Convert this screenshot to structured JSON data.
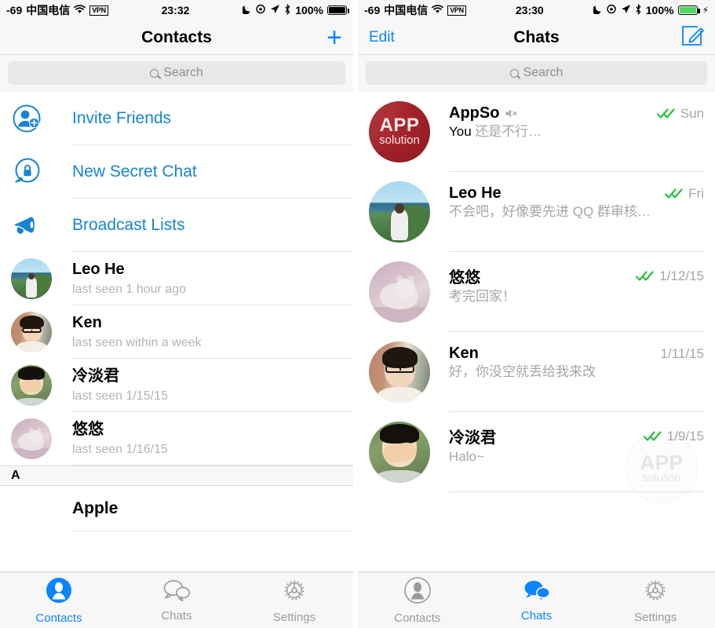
{
  "left": {
    "statusbar": {
      "signal": "-69",
      "carrier": "中国电信",
      "wifi_icon": "wifi-icon",
      "vpn": "VPN",
      "time": "23:32",
      "moon_icon": "do-not-disturb-moon-icon",
      "lock_icon": "rotation-lock-icon",
      "location_icon": "location-arrow-icon",
      "bluetooth_icon": "bluetooth-icon",
      "battery_pct": "100%",
      "battery_style": "black"
    },
    "navbar": {
      "title": "Contacts",
      "right_icon": "plus-icon",
      "right_label": "+"
    },
    "search": {
      "placeholder": "Search",
      "icon": "search-icon"
    },
    "actions": [
      {
        "label": "Invite Friends",
        "icon": "add-person-icon"
      },
      {
        "label": "New Secret Chat",
        "icon": "lock-bubble-icon"
      },
      {
        "label": "Broadcast Lists",
        "icon": "megaphone-icon"
      }
    ],
    "contacts": [
      {
        "first": "Leo",
        "last": "He",
        "name": "Leo He",
        "status": "last seen 1 hour ago",
        "avatar": "leo"
      },
      {
        "first": "Ken",
        "last": "",
        "name": "Ken",
        "status": "last seen within a week",
        "avatar": "ken"
      },
      {
        "first": "冷淡君",
        "last": "",
        "name": "冷淡君",
        "status": "last seen 1/15/15",
        "avatar": "leng"
      },
      {
        "first": "悠悠",
        "last": "",
        "name": "悠悠",
        "status": "last seen 1/16/15",
        "avatar": "cat"
      }
    ],
    "section_header": "A",
    "section_items": [
      {
        "name": "Apple"
      }
    ],
    "tabs": [
      {
        "label": "Contacts",
        "icon": "person-icon",
        "active": true
      },
      {
        "label": "Chats",
        "icon": "bubbles-icon",
        "active": false
      },
      {
        "label": "Settings",
        "icon": "gear-icon",
        "active": false
      }
    ]
  },
  "right": {
    "statusbar": {
      "signal": "-69",
      "carrier": "中国电信",
      "wifi_icon": "wifi-icon",
      "vpn": "VPN",
      "time": "23:30",
      "moon_icon": "do-not-disturb-moon-icon",
      "lock_icon": "rotation-lock-icon",
      "location_icon": "location-arrow-icon",
      "bluetooth_icon": "bluetooth-icon",
      "battery_pct": "100%",
      "battery_style": "green-charging",
      "charging_icon": "lightning-bolt-icon"
    },
    "navbar": {
      "left_label": "Edit",
      "title": "Chats",
      "right_icon": "compose-icon"
    },
    "search": {
      "placeholder": "Search",
      "icon": "search-icon"
    },
    "chats": [
      {
        "name": "AppSo",
        "muted": true,
        "mute_icon": "mute-speaker-icon",
        "sender": "You",
        "message": "还是不行…",
        "ticks": true,
        "date": "Sun",
        "avatar": "appso"
      },
      {
        "name": "Leo He",
        "muted": false,
        "sender": "",
        "message": "不会吧，好像要先进 QQ 群审核…",
        "ticks": true,
        "date": "Fri",
        "avatar": "leo"
      },
      {
        "name": "悠悠",
        "muted": false,
        "sender": "",
        "message": "考完回家！",
        "ticks": true,
        "date": "1/12/15",
        "avatar": "cat"
      },
      {
        "name": "Ken",
        "muted": false,
        "sender": "",
        "message": "好，你没空就丢给我来改",
        "ticks": false,
        "date": "1/11/15",
        "avatar": "ken"
      },
      {
        "name": "冷淡君",
        "muted": false,
        "sender": "",
        "message": "Halo~",
        "ticks": true,
        "date": "1/9/15",
        "avatar": "leng"
      }
    ],
    "watermark": {
      "line1": "APP",
      "line2": "solution"
    },
    "tabs": [
      {
        "label": "Contacts",
        "icon": "person-icon",
        "active": false
      },
      {
        "label": "Chats",
        "icon": "bubbles-icon",
        "active": true
      },
      {
        "label": "Settings",
        "icon": "gear-icon",
        "active": false
      }
    ]
  },
  "colors": {
    "accent_blue": "#0b84ff",
    "link_blue": "#1783d6",
    "tick_green": "#27c23c",
    "subtitle_gray": "#b4b4b4",
    "bar_gray": "#f7f7f7"
  }
}
